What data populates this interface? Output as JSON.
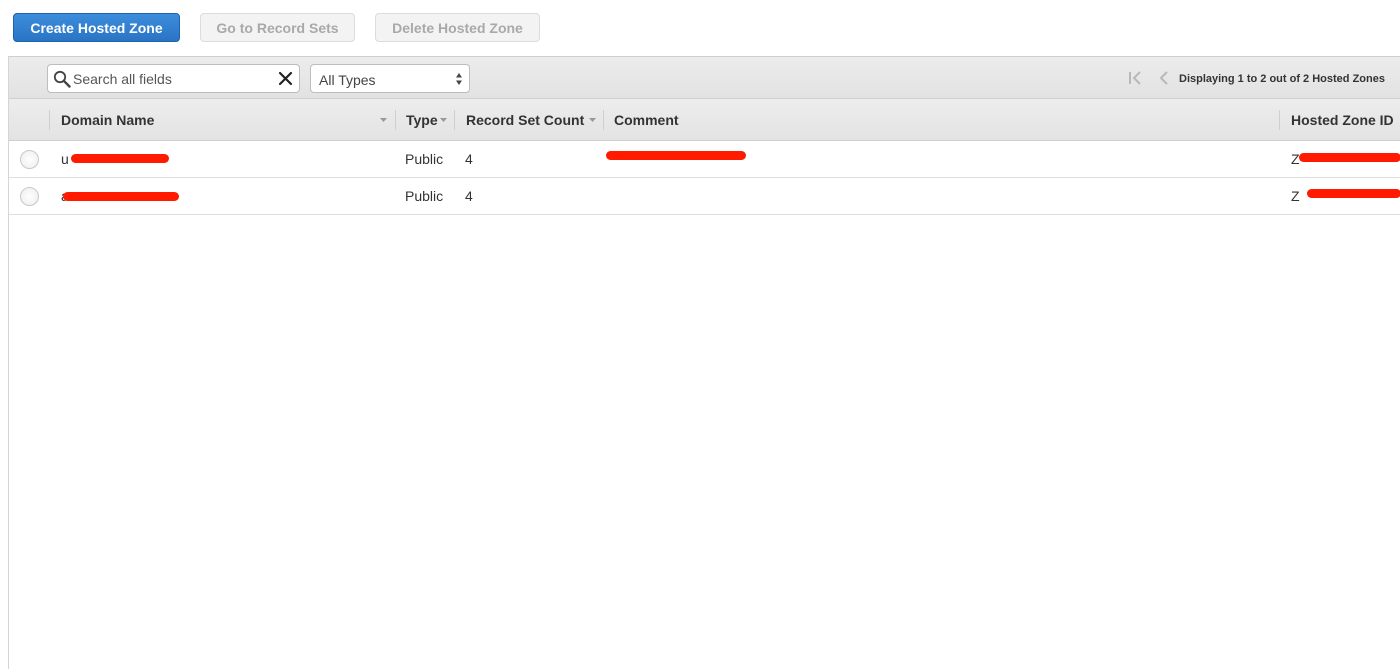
{
  "toolbar": {
    "create_label": "Create Hosted Zone",
    "records_label": "Go to Record Sets",
    "delete_label": "Delete Hosted Zone"
  },
  "filter": {
    "search_placeholder": "Search all fields",
    "type_selected": "All Types"
  },
  "pager": {
    "text": "Displaying 1 to 2 out of 2 Hosted Zones"
  },
  "table": {
    "columns": [
      "Domain Name",
      "Type",
      "Record Set Count",
      "Comment",
      "Hosted Zone ID"
    ],
    "rows": [
      {
        "domain": "u",
        "type": "Public",
        "count": "4",
        "comment": "",
        "zone_id": "Z"
      },
      {
        "domain": "a",
        "type": "Public",
        "count": "4",
        "comment": "",
        "zone_id": "Z"
      }
    ]
  },
  "colors": {
    "primary_button": "#2a74c4",
    "redaction": "#ff1a00"
  },
  "icons": {
    "search": "search-icon",
    "clear": "close-icon",
    "select_arrows": "select-arrows-icon",
    "first_page": "first-page-icon",
    "prev_page": "prev-page-icon",
    "sort": "sort-down-icon"
  }
}
